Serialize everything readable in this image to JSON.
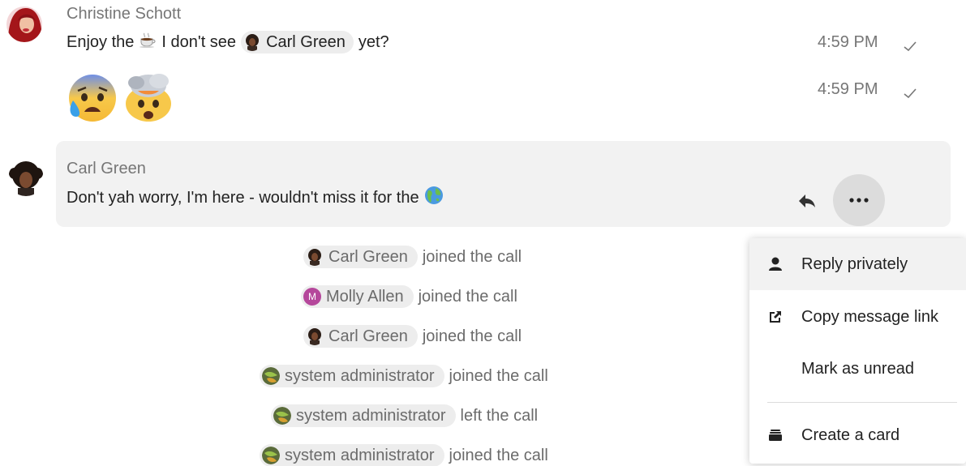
{
  "messages": [
    {
      "author": "Christine Schott",
      "text_before": "Enjoy the",
      "text_middle": "I don't see",
      "mention": "Carl Green",
      "text_after": "yet?",
      "time": "4:59 PM"
    },
    {
      "emojis": [
        "anxious-face-with-sweat",
        "exploding-head"
      ],
      "time": "4:59 PM"
    },
    {
      "author": "Carl Green",
      "text": "Don't yah worry, I'm here - wouldn't miss it for the"
    }
  ],
  "system_events": [
    {
      "user": "Carl Green",
      "action": "joined the call"
    },
    {
      "user": "Molly Allen",
      "avatar_initial": "M",
      "action": "joined the call"
    },
    {
      "user": "Carl Green",
      "action": "joined the call"
    },
    {
      "user": "system administrator",
      "action": "joined the call"
    },
    {
      "user": "system administrator",
      "action": "left the call"
    },
    {
      "user": "system administrator",
      "action": "joined the call"
    }
  ],
  "menu": {
    "items": [
      {
        "label": "Reply privately",
        "icon": "user-icon"
      },
      {
        "label": "Copy message link",
        "icon": "external-link-icon"
      },
      {
        "label": "Mark as unread",
        "icon": ""
      },
      {
        "label": "Create a card",
        "icon": "deck-icon"
      }
    ]
  },
  "colors": {
    "molly_avatar": "#b5479b",
    "highlight_bg": "#f2f2f2",
    "more_button_bg": "#dcdcdc"
  }
}
